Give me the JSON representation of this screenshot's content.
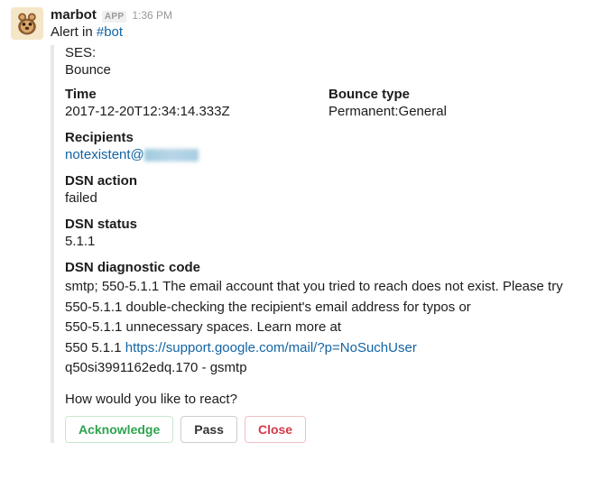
{
  "header": {
    "username": "marbot",
    "app_badge": "APP",
    "timestamp": "1:36 PM"
  },
  "alert": {
    "prefix": "Alert in ",
    "channel": "#bot"
  },
  "attachment": {
    "ses_label": "SES:",
    "bounce": "Bounce",
    "time": {
      "label": "Time",
      "value": "2017-12-20T12:34:14.333Z"
    },
    "bounce_type": {
      "label": "Bounce type",
      "value": "Permanent:General"
    },
    "recipients": {
      "label": "Recipients",
      "value_prefix": "notexistent@"
    },
    "dsn_action": {
      "label": "DSN action",
      "value": "failed"
    },
    "dsn_status": {
      "label": "DSN status",
      "value": "5.1.1"
    },
    "dsn_diag": {
      "label": "DSN diagnostic code",
      "line1": "smtp; 550-5.1.1 The email account that you tried to reach does not exist. Please try",
      "line2": "550-5.1.1 double-checking the recipient's email address for typos or",
      "line3": "550-5.1.1 unnecessary spaces. Learn more at",
      "line4_prefix": "550 5.1.1  ",
      "line4_link": "https://support.google.com/mail/?p=NoSuchUser",
      "line5": "q50si3991162edq.170 - gsmtp"
    },
    "react_prompt": "How would you like to react?",
    "buttons": {
      "ack": "Acknowledge",
      "pass": "Pass",
      "close": "Close"
    }
  }
}
